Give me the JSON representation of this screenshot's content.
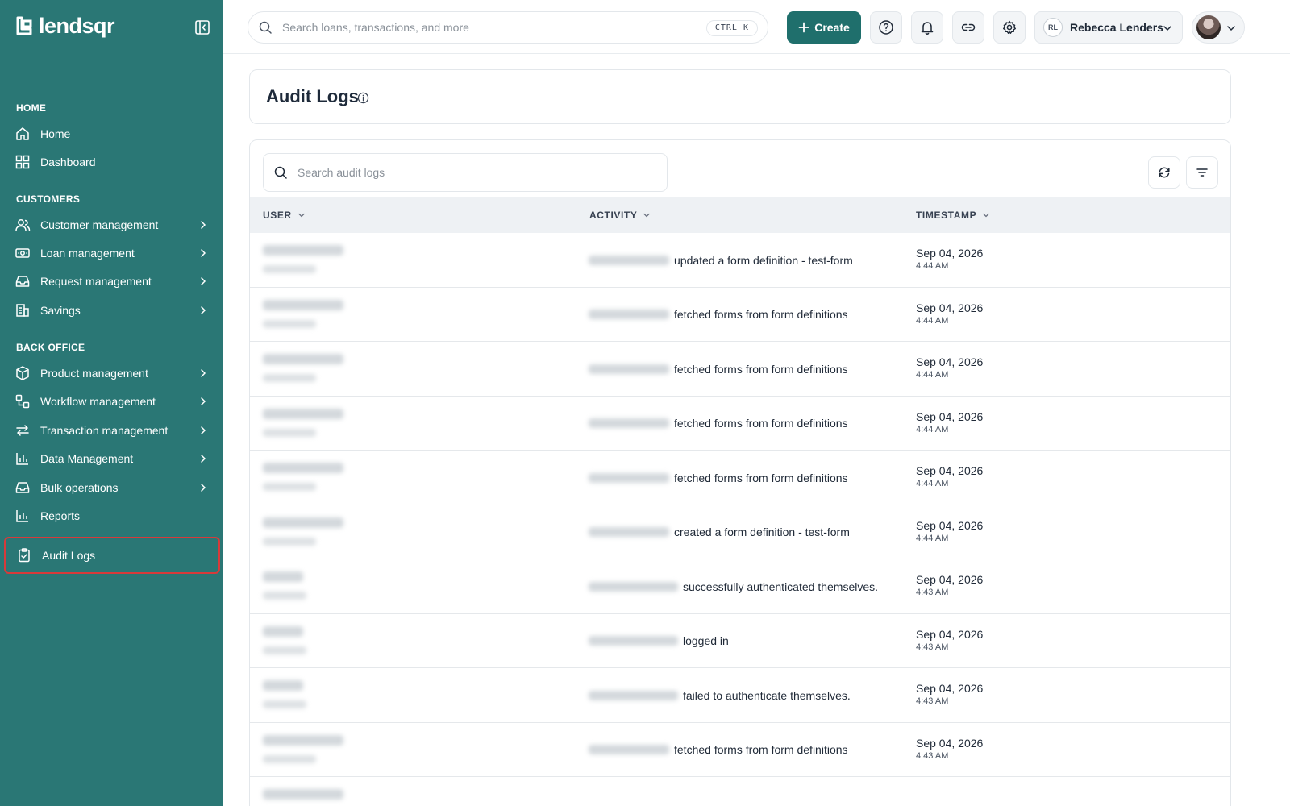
{
  "brand": {
    "name": "lendsqr"
  },
  "sidebar": {
    "sections": [
      {
        "title": "HOME"
      },
      {
        "title": "CUSTOMERS"
      },
      {
        "title": "BACK OFFICE"
      }
    ],
    "items": [
      {
        "label": "Home",
        "icon": "home-icon"
      },
      {
        "label": "Dashboard",
        "icon": "dashboard-icon"
      },
      {
        "label": "Customer management",
        "icon": "users-icon"
      },
      {
        "label": "Loan management",
        "icon": "cash-icon"
      },
      {
        "label": "Request management",
        "icon": "inbox-icon"
      },
      {
        "label": "Savings",
        "icon": "building-icon"
      },
      {
        "label": "Product management",
        "icon": "box-icon"
      },
      {
        "label": "Workflow management",
        "icon": "workflow-icon"
      },
      {
        "label": "Transaction management",
        "icon": "transfer-icon"
      },
      {
        "label": "Data Management",
        "icon": "bar-chart-icon"
      },
      {
        "label": "Bulk operations",
        "icon": "inbox-icon"
      },
      {
        "label": "Reports",
        "icon": "bar-chart-icon"
      },
      {
        "label": "Audit Logs",
        "icon": "clipboard-check-icon",
        "active": true
      }
    ]
  },
  "topbar": {
    "search_placeholder": "Search loans, transactions, and more",
    "shortcut": "CTRL  K",
    "create_label": "Create",
    "user_initials": "RL",
    "user_name": "Rebecca Lenders"
  },
  "page": {
    "title": "Audit Logs",
    "search_placeholder": "Search audit logs"
  },
  "table": {
    "columns": [
      "USER",
      "ACTIVITY",
      "TIMESTAMP"
    ],
    "rows": [
      {
        "activity": "updated a form definition - test-form",
        "date": "Sep 04, 2026",
        "time": "4:44 AM"
      },
      {
        "activity": "fetched forms from form definitions",
        "date": "Sep 04, 2026",
        "time": "4:44 AM"
      },
      {
        "activity": "fetched forms from form definitions",
        "date": "Sep 04, 2026",
        "time": "4:44 AM"
      },
      {
        "activity": "fetched forms from form definitions",
        "date": "Sep 04, 2026",
        "time": "4:44 AM"
      },
      {
        "activity": "fetched forms from form definitions",
        "date": "Sep 04, 2026",
        "time": "4:44 AM"
      },
      {
        "activity": "created a form definition - test-form",
        "date": "Sep 04, 2026",
        "time": "4:44 AM"
      },
      {
        "activity": "successfully authenticated themselves.",
        "date": "Sep 04, 2026",
        "time": "4:43 AM"
      },
      {
        "activity": "logged in",
        "date": "Sep 04, 2026",
        "time": "4:43 AM"
      },
      {
        "activity": "failed to authenticate themselves.",
        "date": "Sep 04, 2026",
        "time": "4:43 AM"
      },
      {
        "activity": "fetched forms from form definitions",
        "date": "Sep 04, 2026",
        "time": "4:43 AM"
      }
    ]
  },
  "colors": {
    "sidebar_bg": "#2a7775",
    "primary_button": "#1f6f6c",
    "active_outline": "#d83a3a"
  }
}
